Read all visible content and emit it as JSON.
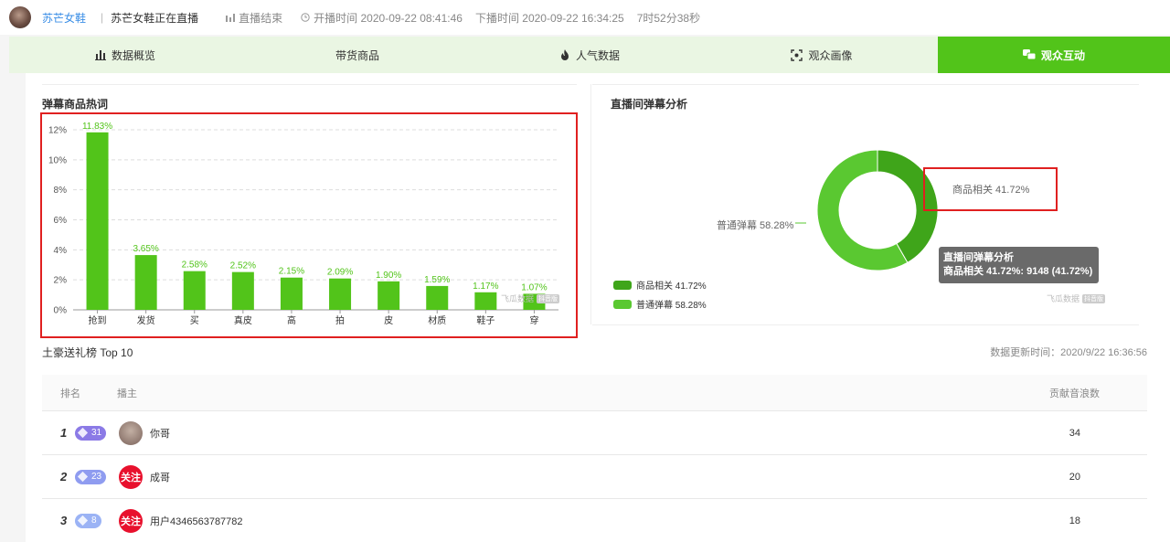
{
  "header": {
    "shop_name": "苏芒女鞋",
    "live_title": "苏芒女鞋正在直播",
    "status": "直播结束",
    "start_time": "开播时间 2020-09-22 08:41:46",
    "end_time": "下播时间 2020-09-22 16:34:25",
    "duration": "7时52分38秒"
  },
  "tabs": [
    {
      "label": "数据概览",
      "icon": "bar-chart-icon"
    },
    {
      "label": "带货商品",
      "icon": ""
    },
    {
      "label": "人气数据",
      "icon": "flame-icon"
    },
    {
      "label": "观众画像",
      "icon": "scan-icon"
    },
    {
      "label": "观众互动",
      "icon": "chat-icon",
      "active": true
    }
  ],
  "left_panel": {
    "title": "弹幕商品热词"
  },
  "right_panel": {
    "title": "直播间弹幕分析"
  },
  "watermark": {
    "text": "飞瓜数据",
    "badge": "抖音版"
  },
  "chart_data": [
    {
      "type": "bar",
      "title": "弹幕商品热词",
      "categories": [
        "抢到",
        "发货",
        "买",
        "真皮",
        "高",
        "拍",
        "皮",
        "材质",
        "鞋子",
        "穿"
      ],
      "values": [
        11.83,
        3.65,
        2.58,
        2.52,
        2.15,
        2.09,
        1.9,
        1.59,
        1.17,
        1.07
      ],
      "value_labels": [
        "11.83%",
        "3.65%",
        "2.58%",
        "2.52%",
        "2.15%",
        "2.09%",
        "1.90%",
        "1.59%",
        "1.17%",
        "1.07%"
      ],
      "y_ticks": [
        "0%",
        "2%",
        "4%",
        "6%",
        "8%",
        "10%",
        "12%"
      ],
      "ylim": [
        0,
        12
      ],
      "grid": true,
      "color": "#52c41a"
    },
    {
      "type": "pie",
      "title": "直播间弹幕分析",
      "categories": [
        "商品相关",
        "普通弹幕"
      ],
      "values": [
        41.72,
        58.28
      ],
      "slice_labels": [
        "商品相关 41.72%",
        "普通弹幕 58.28%"
      ],
      "legend_labels": [
        "商品相关 41.72%",
        "普通弹幕 58.28%"
      ],
      "colors": [
        "#3fa51a",
        "#5ac831"
      ],
      "legend_position": "bottom-left",
      "tooltip": {
        "title": "直播间弹幕分析",
        "text": "商品相关 41.72%: 9148 (41.72%)"
      }
    }
  ],
  "gift_ranking": {
    "title": "土豪送礼榜 Top 10",
    "update_time": "数据更新时间：2020/9/22 16:36:56",
    "columns": {
      "rank": "排名",
      "anchor": "播主",
      "contribution": "贡献音浪数"
    },
    "rows": [
      {
        "rank": "1",
        "level": "31",
        "name": "你哥",
        "value": "34",
        "avatar_text": "",
        "level_color": "#8b7ae6",
        "avatar_color": "#9a8275"
      },
      {
        "rank": "2",
        "level": "23",
        "name": "成哥",
        "value": "20",
        "avatar_text": "关注",
        "level_color": "#8f9cf0",
        "avatar_color": "#e8112d"
      },
      {
        "rank": "3",
        "level": "8",
        "name": "用户4346563787782",
        "value": "18",
        "avatar_text": "关注",
        "level_color": "#9bb3f5",
        "avatar_color": "#e8112d"
      }
    ]
  }
}
